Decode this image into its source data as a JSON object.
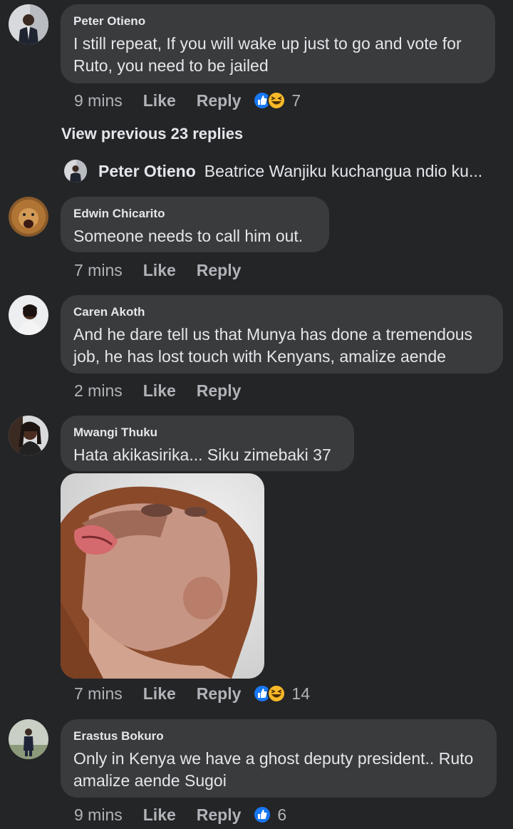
{
  "comments": [
    {
      "name": "Peter Otieno",
      "text": "I still repeat, If you will wake up just to go and vote for Ruto, you need to be jailed",
      "time": "9 mins",
      "like": "Like",
      "reply": "Reply",
      "reaction_count": "7"
    },
    {
      "name": "Edwin Chicarito",
      "text": "Someone needs to call him out.",
      "time": "7 mins",
      "like": "Like",
      "reply": "Reply"
    },
    {
      "name": "Caren Akoth",
      "text": "And he dare tell us that Munya has done a tremendous job, he has lost touch with Kenyans, amalize aende",
      "time": "2 mins",
      "like": "Like",
      "reply": "Reply"
    },
    {
      "name": "Mwangi Thuku",
      "text": "Hata akikasirika... Siku zimebaki 37",
      "time": "7 mins",
      "like": "Like",
      "reply": "Reply",
      "reaction_count": "14"
    },
    {
      "name": "Erastus Bokuro",
      "text": "Only in Kenya we have a ghost deputy president.. Ruto amalize aende Sugoi",
      "time": "9 mins",
      "like": "Like",
      "reply": "Reply",
      "reaction_count": "6"
    }
  ],
  "view_previous": "View previous 23 replies",
  "reply_preview": {
    "name": "Peter Otieno",
    "text": "Beatrice Wanjiku kuchangua ndio ku..."
  },
  "icons": {
    "like": "like-reaction-icon",
    "haha": "haha-reaction-icon"
  },
  "colors": {
    "background": "#242527",
    "bubble": "#3a3b3c",
    "like_blue": "#1877f2",
    "haha_yellow": "#f7b928"
  }
}
